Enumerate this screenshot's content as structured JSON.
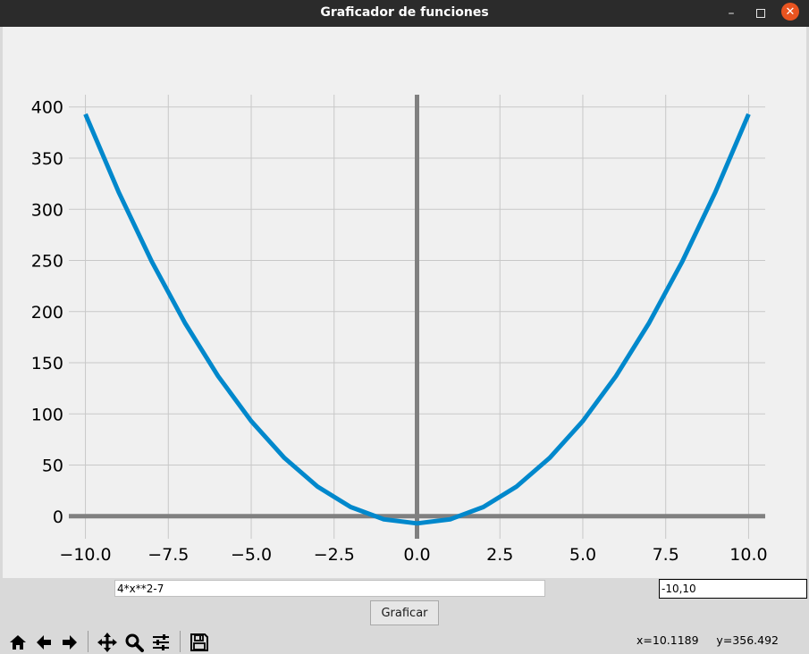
{
  "window": {
    "title": "Graficador de funciones",
    "minimize_glyph": "–",
    "close_glyph": "✕"
  },
  "chart_data": {
    "type": "line",
    "title": "",
    "xlabel": "",
    "ylabel": "",
    "function": "4*x**2-7",
    "x_range": [
      -10,
      10
    ],
    "xlim": [
      -10.5,
      10.5
    ],
    "ylim": [
      -22,
      412
    ],
    "x_ticks": [
      -10,
      -7.5,
      -5,
      -2.5,
      0,
      2.5,
      5,
      7.5,
      10
    ],
    "x_tick_labels": [
      "−10.0",
      "−7.5",
      "−5.0",
      "−2.5",
      "0.0",
      "2.5",
      "5.0",
      "7.5",
      "10.0"
    ],
    "y_ticks": [
      0,
      50,
      100,
      150,
      200,
      250,
      300,
      350,
      400
    ],
    "y_tick_labels": [
      "0",
      "50",
      "100",
      "150",
      "200",
      "250",
      "300",
      "350",
      "400"
    ],
    "grid": true,
    "series": [
      {
        "color": "#0088cc",
        "x": [
          -10,
          -9,
          -8,
          -7,
          -6,
          -5,
          -4,
          -3,
          -2,
          -1,
          0,
          1,
          2,
          3,
          4,
          5,
          6,
          7,
          8,
          9,
          10
        ],
        "y": [
          393,
          317,
          249,
          189,
          137,
          93,
          57,
          29,
          9,
          -3,
          -7,
          -3,
          9,
          29,
          57,
          93,
          137,
          189,
          249,
          317,
          393
        ]
      }
    ],
    "axis_line_color": "#808080"
  },
  "controls": {
    "function_value": "4*x**2-7",
    "range_value": "-10,10",
    "plot_button_label": "Graficar"
  },
  "toolbar": {
    "icons": [
      "home-icon",
      "back-icon",
      "forward-icon",
      "pan-icon",
      "zoom-icon",
      "configure-subplots-icon",
      "save-icon"
    ]
  },
  "status": {
    "coords_text": "x=10.1189     y=356.492"
  }
}
